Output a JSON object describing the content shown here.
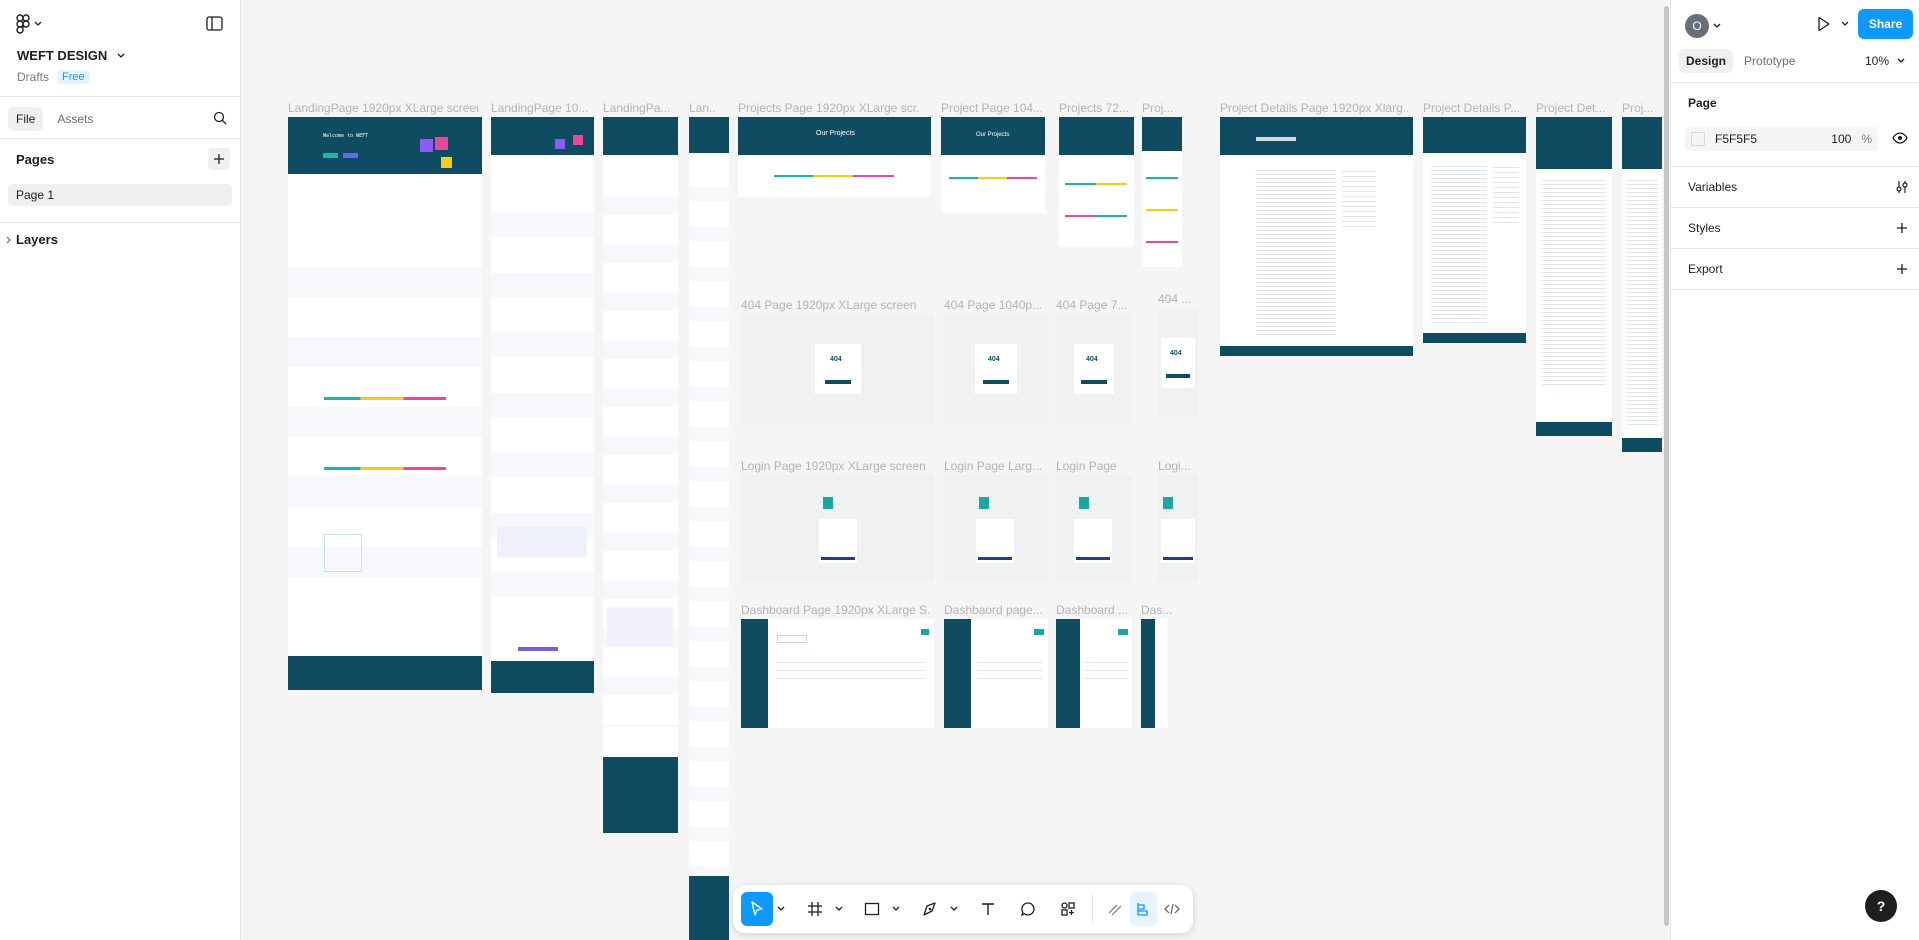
{
  "app": {
    "logo_icon": "figma-logo-icon"
  },
  "file": {
    "name": "WEFT DESIGN",
    "location": "Drafts",
    "plan": "Free"
  },
  "left_tabs": {
    "file": "File",
    "assets": "Assets"
  },
  "pages_section": {
    "title": "Pages",
    "items": [
      "Page 1"
    ]
  },
  "layers_section": {
    "title": "Layers"
  },
  "right_panel": {
    "user_initial": "O",
    "share_label": "Share",
    "tabs": {
      "design": "Design",
      "prototype": "Prototype"
    },
    "zoom": "10%",
    "page_title": "Page",
    "bg_color_hex": "F5F5F5",
    "bg_opacity": "100",
    "bg_opacity_unit": "%",
    "sections": {
      "variables": "Variables",
      "styles": "Styles",
      "export": "Export"
    }
  },
  "help_label": "?",
  "canvas_frames": {
    "landing": [
      "LandingPage 1920px XLarge screen",
      "LandingPage 10...",
      "LandingPa...",
      "Lan..."
    ],
    "projects": [
      "Projects Page 1920px XLarge scr...",
      "Project Page 104...",
      "Projects 72...",
      "Proj..."
    ],
    "details": [
      "Project Details Page 1920px Xlarg...",
      "Project Details P...",
      "Project Det...",
      "Proj..."
    ],
    "p404": [
      "404 Page 1920px XLarge screen",
      "404 Page 1040p...",
      "404 Page 7...",
      "404 ..."
    ],
    "login": [
      "Login Page 1920px XLarge screen",
      "Login Page Larg...",
      "Login Page",
      "Logi..."
    ],
    "dashboard": [
      "Dashboard Page 1920px XLarge S...",
      "Dashbaord page...",
      "Dashboard ...",
      "Das..."
    ]
  },
  "frame_texts": {
    "our_projects": "Our Projects",
    "err_code": "404",
    "welcome": "Welcome to WEFT"
  },
  "toolbar": {
    "tools": [
      "move-tool",
      "frame-tool",
      "shape-tool",
      "pen-tool",
      "text-tool",
      "comment-tool",
      "actions-tool",
      "draw-mode",
      "design-mode",
      "dev-mode"
    ]
  },
  "colors": {
    "accent": "#0D99FF",
    "brand_dark": "#0f4b61",
    "canvas_bg": "#F5F5F5"
  }
}
